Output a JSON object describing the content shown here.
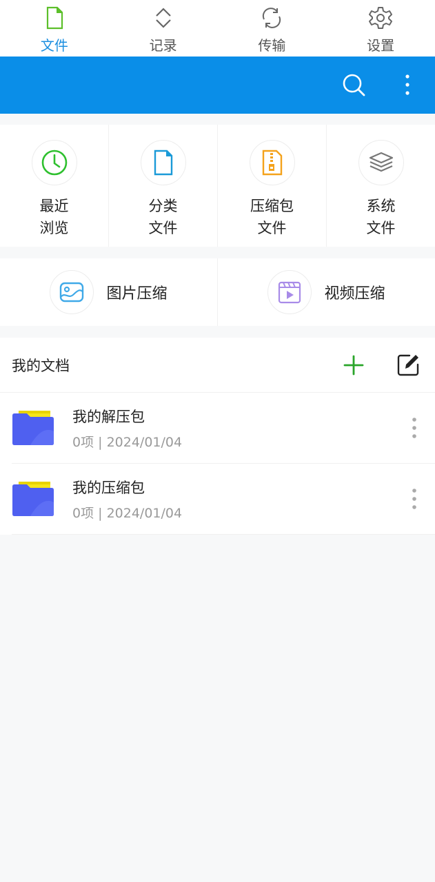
{
  "nav": {
    "items": [
      {
        "label": "文件",
        "icon": "file-icon",
        "active": true
      },
      {
        "label": "记录",
        "icon": "expand-icon"
      },
      {
        "label": "传输",
        "icon": "sync-icon"
      },
      {
        "label": "设置",
        "icon": "gear-icon"
      }
    ]
  },
  "toolbar": {
    "color": "#0a8ee8",
    "search_icon": "search-icon",
    "more_icon": "more-vertical-icon"
  },
  "quick": [
    {
      "label": "最近\n浏览",
      "icon": "clock-icon",
      "color": "#2ec02e"
    },
    {
      "label": "分类\n文件",
      "icon": "document-icon",
      "color": "#1a9ad8"
    },
    {
      "label": "压缩包\n文件",
      "icon": "zip-icon",
      "color": "#f4a21b"
    },
    {
      "label": "系统\n文件",
      "icon": "layers-icon",
      "color": "#777777"
    }
  ],
  "compress": [
    {
      "label": "图片压缩",
      "icon": "image-icon",
      "color": "#3fa9e8"
    },
    {
      "label": "视频压缩",
      "icon": "video-icon",
      "color": "#a88be8"
    }
  ],
  "docs": {
    "title": "我的文档",
    "add_icon": "plus-icon",
    "edit_icon": "edit-icon",
    "items": [
      {
        "name": "我的解压包",
        "meta": "0项 | 2024/01/04"
      },
      {
        "name": "我的压缩包",
        "meta": "0项 | 2024/01/04"
      }
    ]
  }
}
